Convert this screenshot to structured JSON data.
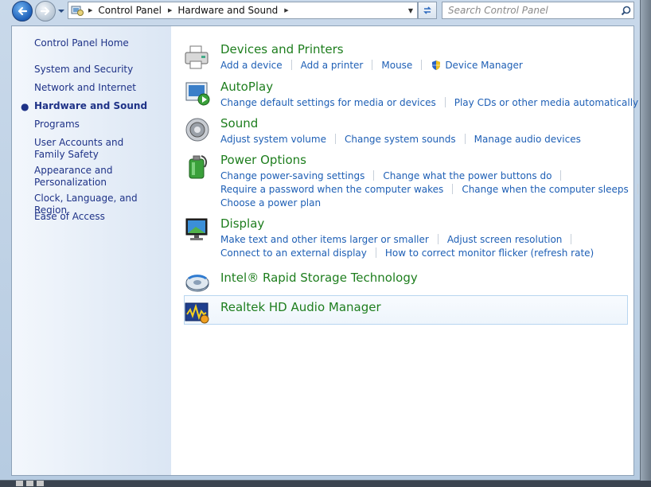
{
  "nav": {
    "breadcrumb": [
      "Control Panel",
      "Hardware and Sound"
    ],
    "search_placeholder": "Search Control Panel"
  },
  "sidebar": {
    "items": [
      {
        "label": "Control Panel Home",
        "active": false
      },
      {
        "label": "System and Security",
        "active": false
      },
      {
        "label": "Network and Internet",
        "active": false
      },
      {
        "label": "Hardware and Sound",
        "active": true
      },
      {
        "label": "Programs",
        "active": false
      },
      {
        "label": "User Accounts and Family Safety",
        "active": false
      },
      {
        "label": "Appearance and Personalization",
        "active": false
      },
      {
        "label": "Clock, Language, and Region",
        "active": false
      },
      {
        "label": "Ease of Access",
        "active": false
      }
    ]
  },
  "categories": [
    {
      "title": "Devices and Printers",
      "icon": "printer-icon",
      "rows": [
        [
          "Add a device",
          "Add a printer",
          "Mouse",
          "Device Manager"
        ]
      ]
    },
    {
      "title": "AutoPlay",
      "icon": "autoplay-icon",
      "rows": [
        [
          "Change default settings for media or devices",
          "Play CDs or other media automatically"
        ]
      ]
    },
    {
      "title": "Sound",
      "icon": "speaker-icon",
      "rows": [
        [
          "Adjust system volume",
          "Change system sounds",
          "Manage audio devices"
        ]
      ]
    },
    {
      "title": "Power Options",
      "icon": "battery-icon",
      "rows": [
        [
          "Change power-saving settings",
          "Change what the power buttons do"
        ],
        [
          "Require a password when the computer wakes",
          "Change when the computer sleeps"
        ],
        [
          "Choose a power plan"
        ]
      ]
    },
    {
      "title": "Display",
      "icon": "monitor-icon",
      "rows": [
        [
          "Make text and other items larger or smaller",
          "Adjust screen resolution"
        ],
        [
          "Connect to an external display",
          "How to correct monitor flicker (refresh rate)"
        ]
      ]
    },
    {
      "title": "Intel® Rapid Storage Technology",
      "icon": "storage-icon",
      "rows": []
    },
    {
      "title": "Realtek HD Audio Manager",
      "icon": "audio-manager-icon",
      "rows": []
    }
  ],
  "colors": {
    "link": "#1e5fb5",
    "category_title": "#1e7e1e",
    "sidebar_text": "#1e3287"
  }
}
